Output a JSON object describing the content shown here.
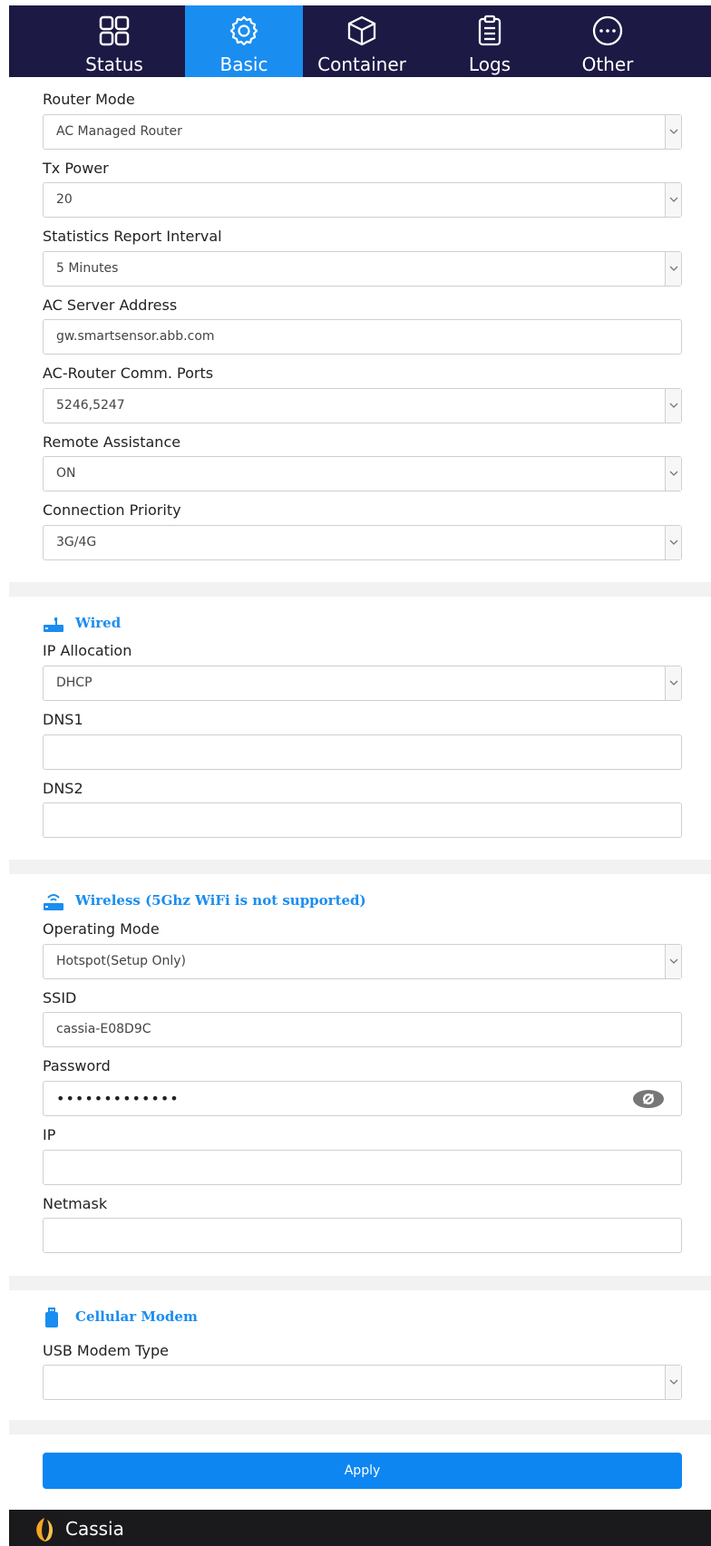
{
  "nav": {
    "tabs": [
      {
        "label": "Status",
        "icon": "grid-icon"
      },
      {
        "label": "Basic",
        "icon": "gear-icon",
        "active": true
      },
      {
        "label": "Container",
        "icon": "box-icon"
      },
      {
        "label": "Logs",
        "icon": "clipboard-icon"
      },
      {
        "label": "Other",
        "icon": "more-icon"
      }
    ]
  },
  "router": {
    "mode_label": "Router Mode",
    "mode_value": "AC Managed Router",
    "tx_label": "Tx Power",
    "tx_value": "20",
    "stats_label": "Statistics Report Interval",
    "stats_value": "5 Minutes",
    "ac_server_label": "AC Server Address",
    "ac_server_value": "gw.smartsensor.abb.com",
    "ports_label": "AC-Router Comm. Ports",
    "ports_value": "5246,5247",
    "remote_label": "Remote Assistance",
    "remote_value": "ON",
    "priority_label": "Connection Priority",
    "priority_value": "3G/4G"
  },
  "wired": {
    "title": "Wired",
    "ip_alloc_label": "IP Allocation",
    "ip_alloc_value": "DHCP",
    "dns1_label": "DNS1",
    "dns1_value": "",
    "dns2_label": "DNS2",
    "dns2_value": ""
  },
  "wireless": {
    "title": "Wireless (5Ghz WiFi is not supported)",
    "mode_label": "Operating Mode",
    "mode_value": "Hotspot(Setup Only)",
    "ssid_label": "SSID",
    "ssid_value": "cassia-E08D9C",
    "password_label": "Password",
    "password_value": "•••••••••••••",
    "ip_label": "IP",
    "ip_value": "",
    "netmask_label": "Netmask",
    "netmask_value": ""
  },
  "cellular": {
    "title": "Cellular Modem",
    "modem_label": "USB Modem Type",
    "modem_value": ""
  },
  "actions": {
    "apply_label": "Apply"
  },
  "footer": {
    "brand": "Cassia"
  },
  "colors": {
    "nav_bg": "#1c1a44",
    "accent": "#1a8df0",
    "footer_bg": "#1a1a1c",
    "section_gap": "#f2f2f2"
  }
}
